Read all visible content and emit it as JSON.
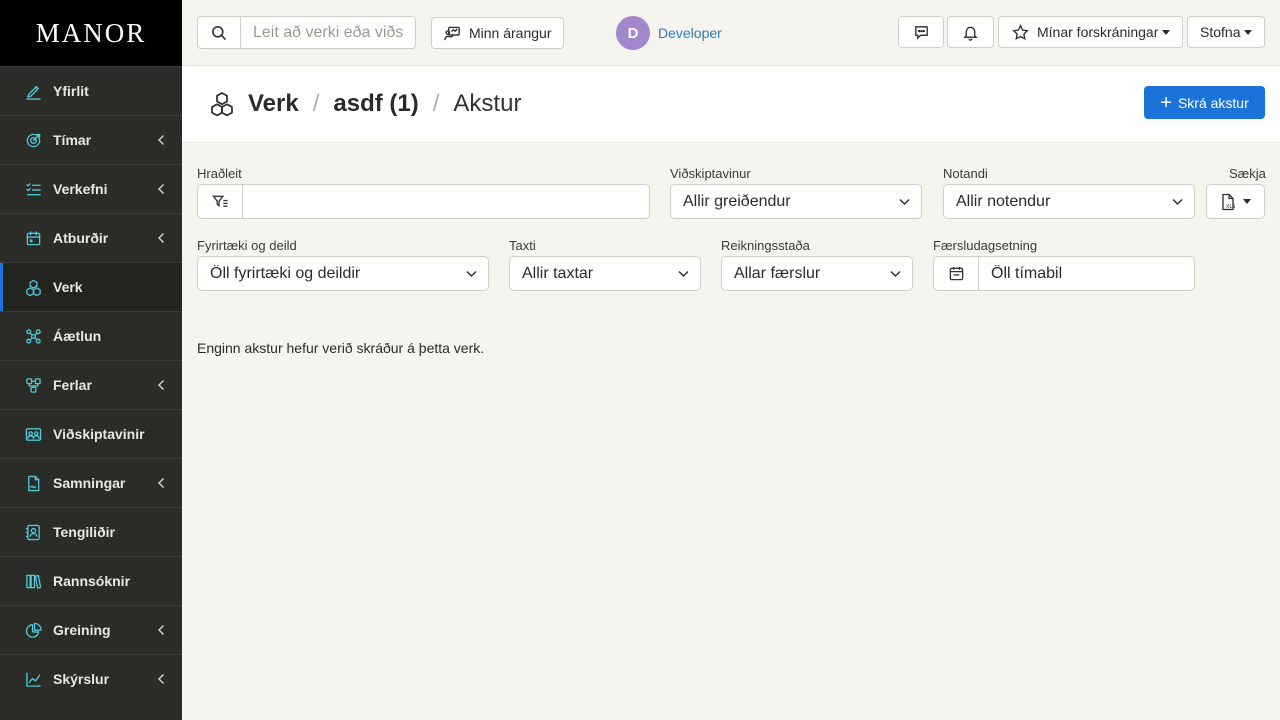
{
  "brand": "MANOR",
  "sidebar": {
    "items": [
      {
        "label": "Yfirlit",
        "icon": "pen-chart-icon",
        "expandable": false,
        "active": false
      },
      {
        "label": "Tímar",
        "icon": "target-icon",
        "expandable": true,
        "active": false
      },
      {
        "label": "Verkefni",
        "icon": "list-check-icon",
        "expandable": true,
        "active": false
      },
      {
        "label": "Atburðir",
        "icon": "calendar-icon",
        "expandable": true,
        "active": false
      },
      {
        "label": "Verk",
        "icon": "cubes-icon",
        "expandable": false,
        "active": true
      },
      {
        "label": "Áætlun",
        "icon": "network-icon",
        "expandable": false,
        "active": false
      },
      {
        "label": "Ferlar",
        "icon": "flow-icon",
        "expandable": true,
        "active": false
      },
      {
        "label": "Viðskiptavinir",
        "icon": "customers-icon",
        "expandable": false,
        "active": false
      },
      {
        "label": "Samningar",
        "icon": "contract-icon",
        "expandable": true,
        "active": false
      },
      {
        "label": "Tengiliðir",
        "icon": "contact-icon",
        "expandable": false,
        "active": false
      },
      {
        "label": "Rannsóknir",
        "icon": "books-icon",
        "expandable": false,
        "active": false
      },
      {
        "label": "Greining",
        "icon": "pie-chart-icon",
        "expandable": true,
        "active": false
      },
      {
        "label": "Skýrslur",
        "icon": "line-chart-icon",
        "expandable": true,
        "active": false
      }
    ]
  },
  "topbar": {
    "search_placeholder": "Leit að verki eða viðs",
    "achievement_label": "Minn árangur",
    "user_initial": "D",
    "user_name": "Developer",
    "favorites_label": "Mínar forskráningar",
    "create_label": "Stofna"
  },
  "header": {
    "crumb_root": "Verk",
    "crumb_project": "asdf (1)",
    "crumb_current": "Akstur",
    "primary_button": "Skrá akstur"
  },
  "filters": {
    "quicksearch_label": "Hraðleit",
    "quicksearch_value": "",
    "customer_label": "Viðskiptavinur",
    "customer_value": "Allir greiðendur",
    "user_label": "Notandi",
    "user_value": "Allir notendur",
    "export_label": "Sækja",
    "company_label": "Fyrirtæki og deild",
    "company_value": "Öll fyrirtæki og deildir",
    "rate_label": "Taxti",
    "rate_value": "Allir taxtar",
    "billing_label": "Reikningsstaða",
    "billing_value": "Allar færslur",
    "date_label": "Færsludagsetning",
    "date_value": "Öll tímabil"
  },
  "empty_message": "Enginn akstur hefur verið skráður á þetta verk.",
  "colors": {
    "accent": "#1a73d9",
    "sidebar_bg": "#2b2b27",
    "icon": "#4fc8d8",
    "avatar": "#a387cc"
  }
}
